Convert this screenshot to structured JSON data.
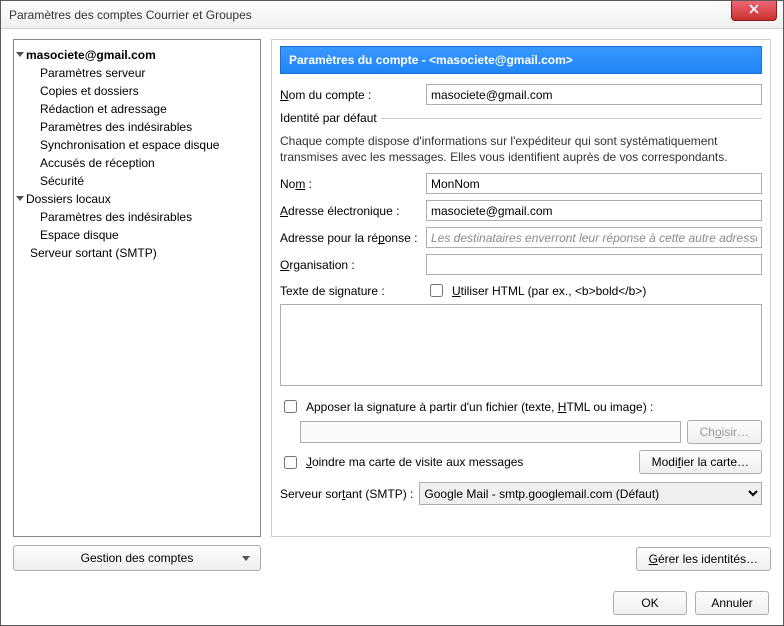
{
  "window": {
    "title": "Paramètres des comptes Courrier et Groupes"
  },
  "tree": {
    "account": "masociete@gmail.com",
    "items": [
      "Paramètres serveur",
      "Copies et dossiers",
      "Rédaction et adressage",
      "Paramètres des indésirables",
      "Synchronisation et espace disque",
      "Accusés de réception",
      "Sécurité"
    ],
    "local": "Dossiers locaux",
    "local_items": [
      "Paramètres des indésirables",
      "Espace disque"
    ],
    "smtp": "Serveur sortant (SMTP)"
  },
  "manage_accounts": "Gestion des comptes",
  "panel": {
    "header_prefix": "Paramètres du compte - ",
    "header_email": "<masociete@gmail.com>",
    "account_name_label": "Nom du compte :",
    "account_name_value": "masociete@gmail.com",
    "identity_legend": "Identité par défaut",
    "identity_desc": "Chaque compte dispose d'informations sur l'expéditeur qui sont systématiquement transmises avec les messages. Elles vous identifient auprès de vos correspondants.",
    "name_label": "Nom :",
    "name_value": "MonNom",
    "email_label": "Adresse électronique :",
    "email_value": "masociete@gmail.com",
    "reply_label": "Adresse pour la réponse :",
    "reply_placeholder": "Les destinataires enverront leur réponse à cette autre adresse",
    "org_label": "Organisation :",
    "sig_label": "Texte de signature :",
    "sig_html_label": "Utiliser HTML (par ex., <b>bold</b>)",
    "sig_file_label": "Apposer la signature à partir d'un fichier (texte, HTML ou image) :",
    "choose_btn": "Choisir…",
    "vcard_label": "Joindre ma carte de visite aux messages",
    "vcard_btn": "Modifier la carte…",
    "smtp_label": "Serveur sortant (SMTP) :",
    "smtp_value": "Google Mail - smtp.googlemail.com (Défaut)",
    "identities_btn": "Gérer les identités…"
  },
  "footer": {
    "ok": "OK",
    "cancel": "Annuler"
  }
}
